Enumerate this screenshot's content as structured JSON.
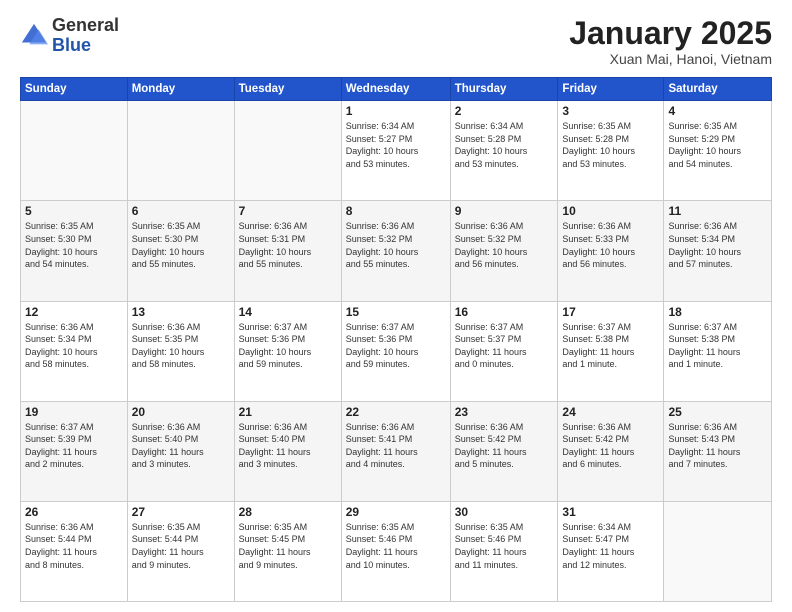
{
  "logo": {
    "general": "General",
    "blue": "Blue"
  },
  "header": {
    "title": "January 2025",
    "subtitle": "Xuan Mai, Hanoi, Vietnam"
  },
  "days_of_week": [
    "Sunday",
    "Monday",
    "Tuesday",
    "Wednesday",
    "Thursday",
    "Friday",
    "Saturday"
  ],
  "weeks": [
    [
      {
        "day": "",
        "info": ""
      },
      {
        "day": "",
        "info": ""
      },
      {
        "day": "",
        "info": ""
      },
      {
        "day": "1",
        "info": "Sunrise: 6:34 AM\nSunset: 5:27 PM\nDaylight: 10 hours\nand 53 minutes."
      },
      {
        "day": "2",
        "info": "Sunrise: 6:34 AM\nSunset: 5:28 PM\nDaylight: 10 hours\nand 53 minutes."
      },
      {
        "day": "3",
        "info": "Sunrise: 6:35 AM\nSunset: 5:28 PM\nDaylight: 10 hours\nand 53 minutes."
      },
      {
        "day": "4",
        "info": "Sunrise: 6:35 AM\nSunset: 5:29 PM\nDaylight: 10 hours\nand 54 minutes."
      }
    ],
    [
      {
        "day": "5",
        "info": "Sunrise: 6:35 AM\nSunset: 5:30 PM\nDaylight: 10 hours\nand 54 minutes."
      },
      {
        "day": "6",
        "info": "Sunrise: 6:35 AM\nSunset: 5:30 PM\nDaylight: 10 hours\nand 55 minutes."
      },
      {
        "day": "7",
        "info": "Sunrise: 6:36 AM\nSunset: 5:31 PM\nDaylight: 10 hours\nand 55 minutes."
      },
      {
        "day": "8",
        "info": "Sunrise: 6:36 AM\nSunset: 5:32 PM\nDaylight: 10 hours\nand 55 minutes."
      },
      {
        "day": "9",
        "info": "Sunrise: 6:36 AM\nSunset: 5:32 PM\nDaylight: 10 hours\nand 56 minutes."
      },
      {
        "day": "10",
        "info": "Sunrise: 6:36 AM\nSunset: 5:33 PM\nDaylight: 10 hours\nand 56 minutes."
      },
      {
        "day": "11",
        "info": "Sunrise: 6:36 AM\nSunset: 5:34 PM\nDaylight: 10 hours\nand 57 minutes."
      }
    ],
    [
      {
        "day": "12",
        "info": "Sunrise: 6:36 AM\nSunset: 5:34 PM\nDaylight: 10 hours\nand 58 minutes."
      },
      {
        "day": "13",
        "info": "Sunrise: 6:36 AM\nSunset: 5:35 PM\nDaylight: 10 hours\nand 58 minutes."
      },
      {
        "day": "14",
        "info": "Sunrise: 6:37 AM\nSunset: 5:36 PM\nDaylight: 10 hours\nand 59 minutes."
      },
      {
        "day": "15",
        "info": "Sunrise: 6:37 AM\nSunset: 5:36 PM\nDaylight: 10 hours\nand 59 minutes."
      },
      {
        "day": "16",
        "info": "Sunrise: 6:37 AM\nSunset: 5:37 PM\nDaylight: 11 hours\nand 0 minutes."
      },
      {
        "day": "17",
        "info": "Sunrise: 6:37 AM\nSunset: 5:38 PM\nDaylight: 11 hours\nand 1 minute."
      },
      {
        "day": "18",
        "info": "Sunrise: 6:37 AM\nSunset: 5:38 PM\nDaylight: 11 hours\nand 1 minute."
      }
    ],
    [
      {
        "day": "19",
        "info": "Sunrise: 6:37 AM\nSunset: 5:39 PM\nDaylight: 11 hours\nand 2 minutes."
      },
      {
        "day": "20",
        "info": "Sunrise: 6:36 AM\nSunset: 5:40 PM\nDaylight: 11 hours\nand 3 minutes."
      },
      {
        "day": "21",
        "info": "Sunrise: 6:36 AM\nSunset: 5:40 PM\nDaylight: 11 hours\nand 3 minutes."
      },
      {
        "day": "22",
        "info": "Sunrise: 6:36 AM\nSunset: 5:41 PM\nDaylight: 11 hours\nand 4 minutes."
      },
      {
        "day": "23",
        "info": "Sunrise: 6:36 AM\nSunset: 5:42 PM\nDaylight: 11 hours\nand 5 minutes."
      },
      {
        "day": "24",
        "info": "Sunrise: 6:36 AM\nSunset: 5:42 PM\nDaylight: 11 hours\nand 6 minutes."
      },
      {
        "day": "25",
        "info": "Sunrise: 6:36 AM\nSunset: 5:43 PM\nDaylight: 11 hours\nand 7 minutes."
      }
    ],
    [
      {
        "day": "26",
        "info": "Sunrise: 6:36 AM\nSunset: 5:44 PM\nDaylight: 11 hours\nand 8 minutes."
      },
      {
        "day": "27",
        "info": "Sunrise: 6:35 AM\nSunset: 5:44 PM\nDaylight: 11 hours\nand 9 minutes."
      },
      {
        "day": "28",
        "info": "Sunrise: 6:35 AM\nSunset: 5:45 PM\nDaylight: 11 hours\nand 9 minutes."
      },
      {
        "day": "29",
        "info": "Sunrise: 6:35 AM\nSunset: 5:46 PM\nDaylight: 11 hours\nand 10 minutes."
      },
      {
        "day": "30",
        "info": "Sunrise: 6:35 AM\nSunset: 5:46 PM\nDaylight: 11 hours\nand 11 minutes."
      },
      {
        "day": "31",
        "info": "Sunrise: 6:34 AM\nSunset: 5:47 PM\nDaylight: 11 hours\nand 12 minutes."
      },
      {
        "day": "",
        "info": ""
      }
    ]
  ]
}
